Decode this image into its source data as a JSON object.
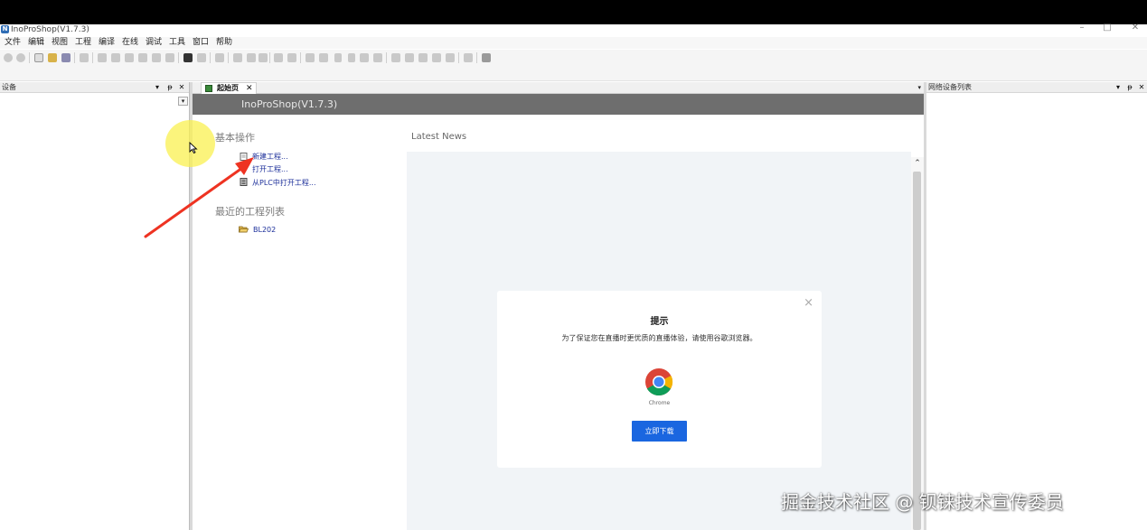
{
  "window": {
    "title": "InoProShop(V1.7.3)",
    "app_icon_letter": "N",
    "controls": [
      "–",
      "□",
      "✕"
    ]
  },
  "menu": [
    "文件",
    "编辑",
    "视图",
    "工程",
    "编译",
    "在线",
    "调试",
    "工具",
    "窗口",
    "帮助"
  ],
  "device_panel": {
    "title": "设备",
    "controls": [
      "▾",
      "ᵽ",
      "✕"
    ],
    "dropdown_arrow": "▾"
  },
  "editor": {
    "tab": {
      "label": "起始页",
      "close": "✕",
      "icon": "start-page-icon"
    },
    "tab_list_arrow": "▾",
    "start_page": {
      "banner_title": "InoProShop(V1.7.3)",
      "basic_ops_title": "基本操作",
      "actions": [
        {
          "label": "新建工程...",
          "icon": "new-project-icon"
        },
        {
          "label": "打开工程...",
          "icon": "open-project-icon"
        },
        {
          "label": "从PLC中打开工程...",
          "icon": "open-from-plc-icon"
        }
      ],
      "recent_title": "最近的工程列表",
      "recent_projects": [
        {
          "label": "BL202",
          "icon": "folder-open-icon"
        }
      ],
      "news_title": "Latest News",
      "scroll_up": "⌃"
    }
  },
  "dialog": {
    "title": "提示",
    "message": "为了保证您在直播时更优质的直播体验，请使用谷歌浏览器。",
    "browser_label": "Chrome",
    "button_label": "立即下载",
    "close": "×"
  },
  "network_panel": {
    "title": "网络设备列表",
    "controls": [
      "▾",
      "ᵽ",
      "✕"
    ]
  },
  "watermark": "掘金技术社区 @ 钡铼技术宣传委员",
  "colors": {
    "banner_bg": "#6e6e6e",
    "link": "#1c2f9a",
    "button": "#1a66e0",
    "annotation_arrow": "#ee3322",
    "cursor_highlight": "#f6ec4a"
  }
}
